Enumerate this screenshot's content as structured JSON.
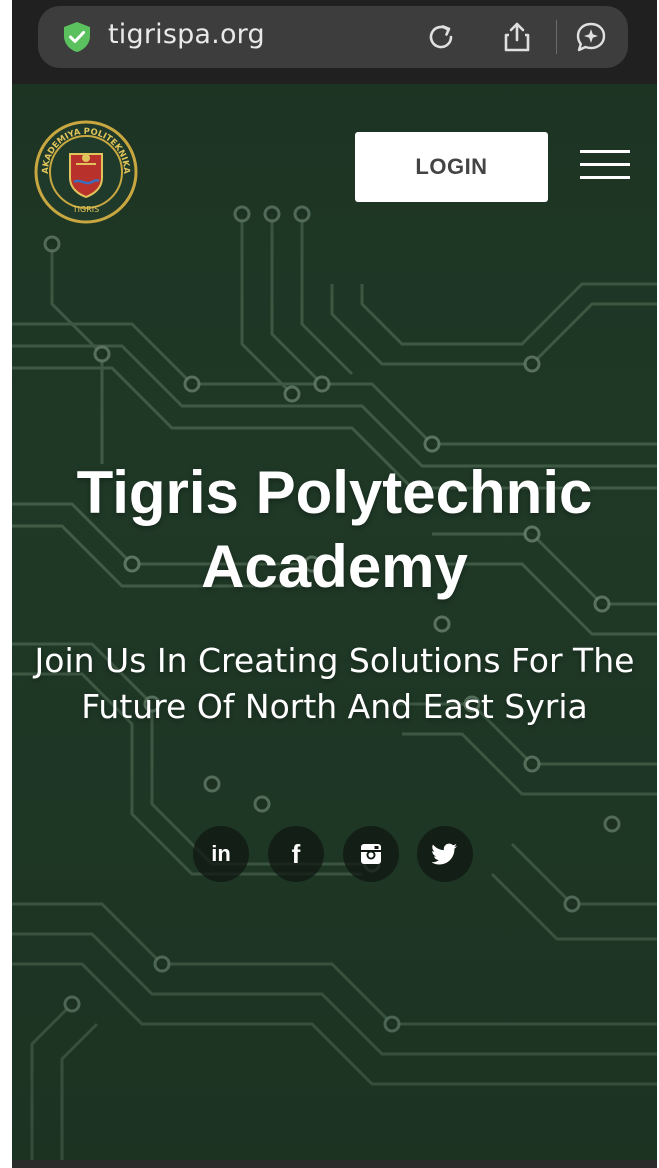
{
  "browser": {
    "url": "tigrispa.org",
    "icons": [
      "shield-check-icon",
      "reload-icon",
      "share-icon",
      "assistant-icon"
    ]
  },
  "header": {
    "logo": {
      "ring_text": "AKADEMIYA POLITEKNIKA",
      "bottom_text": "TIGRIS"
    },
    "login_label": "LOGIN",
    "menu_icon": "hamburger-menu-icon"
  },
  "hero": {
    "title": "Tigris Polytechnic Academy",
    "subtitle": "Join Us In Creating Solutions For The Future Of North And East Syria"
  },
  "social": [
    {
      "name": "linkedin",
      "glyph": "in"
    },
    {
      "name": "facebook",
      "glyph": "f"
    },
    {
      "name": "instagram",
      "glyph": "instagram-icon"
    },
    {
      "name": "twitter",
      "glyph": "twitter-icon"
    }
  ],
  "colors": {
    "hero_bg": "#203a27",
    "trace": "#4f6d55",
    "button_bg": "#ffffff",
    "button_text": "#444444",
    "shield": "#5bc15f"
  }
}
